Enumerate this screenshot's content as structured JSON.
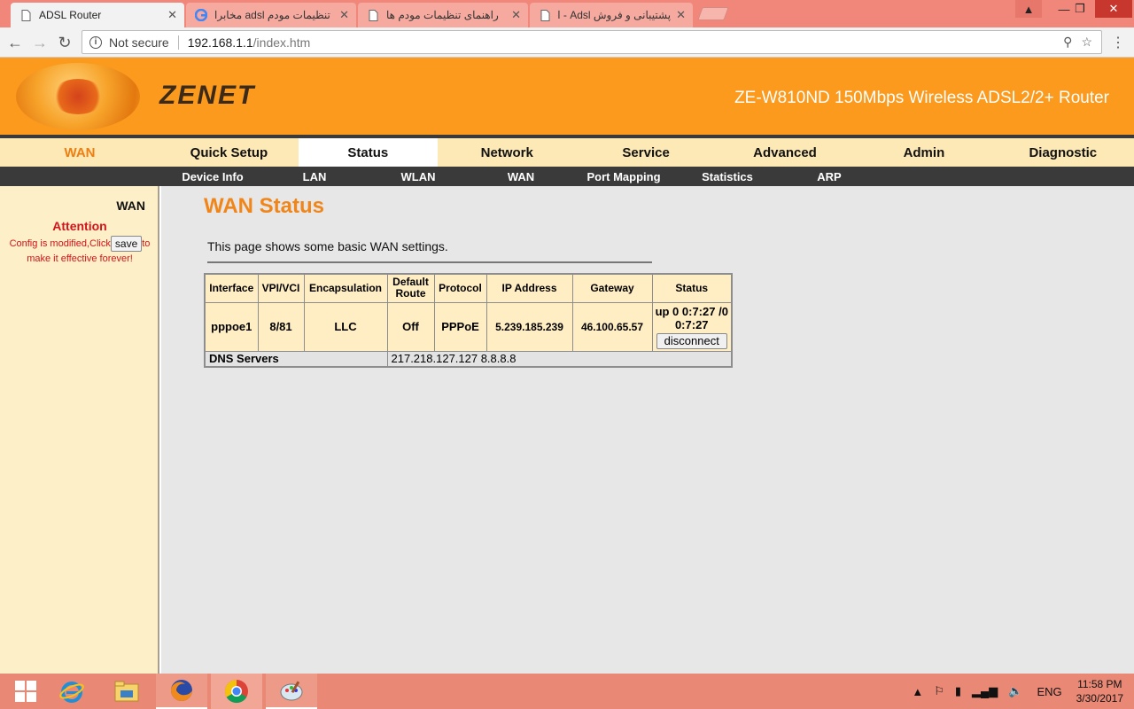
{
  "browser": {
    "tabs": [
      {
        "title": "ADSL Router",
        "icon": "page-icon",
        "active": true
      },
      {
        "title": "تنظیمات مودم adsl مخابرا",
        "icon": "google-icon",
        "active": false
      },
      {
        "title": "راهنمای تنظیمات مودم ها",
        "icon": "page-icon",
        "active": false
      },
      {
        "title": "پشتیبانی و فروش Adsl - ار",
        "icon": "page-icon",
        "active": false
      }
    ],
    "close_glyph": "✕",
    "window_controls": {
      "profile": "▲",
      "minimize": "—",
      "maximize": "❐",
      "close": "✕"
    },
    "nav": {
      "back": "←",
      "forward": "→",
      "reload": "↻",
      "info": "i",
      "menu": "⋮"
    },
    "address": {
      "security": "Not secure",
      "host": "192.168.1.1",
      "path": "/index.htm"
    },
    "omni_icons": {
      "key": "⚲",
      "star": "☆"
    }
  },
  "router": {
    "brand": "ZENET",
    "model": "ZE-W810ND 150Mbps Wireless ADSL2/2+ Router",
    "main_menu": [
      "WAN",
      "Quick Setup",
      "Status",
      "Network",
      "Service",
      "Advanced",
      "Admin",
      "Diagnostic"
    ],
    "active_main": "Status",
    "sub_menu": [
      "Device Info",
      "LAN",
      "WLAN",
      "WAN",
      "Port Mapping",
      "Statistics",
      "ARP"
    ]
  },
  "sidebar": {
    "title": "WAN",
    "attention": "Attention",
    "msg_before": "Config is modified,Click",
    "save_label": "save",
    "msg_after_1": "to",
    "msg_after_2": "make it effective forever!"
  },
  "content": {
    "title": "WAN Status",
    "description": "This page shows some basic WAN settings.",
    "table": {
      "headers": [
        "Interface",
        "VPI/VCI",
        "Encapsulation",
        "Default Route",
        "Protocol",
        "IP Address",
        "Gateway",
        "Status"
      ],
      "row": {
        "interface": "pppoe1",
        "vpi_vci": "8/81",
        "encapsulation": "LLC",
        "default_route": "Off",
        "protocol": "PPPoE",
        "ip": "5.239.185.239",
        "gateway": "46.100.65.57",
        "status_line1": "up 0 0:7:27 /0",
        "status_line2": "0:7:27",
        "disconnect_label": "disconnect"
      },
      "dns_label": "DNS Servers",
      "dns_value": "217.218.127.127 8.8.8.8"
    }
  },
  "taskbar": {
    "apps": [
      "start-icon",
      "ie-icon",
      "file-explorer-icon",
      "firefox-icon",
      "chrome-icon",
      "paint-icon"
    ],
    "lang": "ENG",
    "time": "11:58 PM",
    "date": "3/30/2017",
    "tray_glyphs": {
      "show_hidden": "▲",
      "flag": "⚐",
      "battery": "▮",
      "signal": "▂▄▆",
      "volume": "🔈"
    }
  }
}
